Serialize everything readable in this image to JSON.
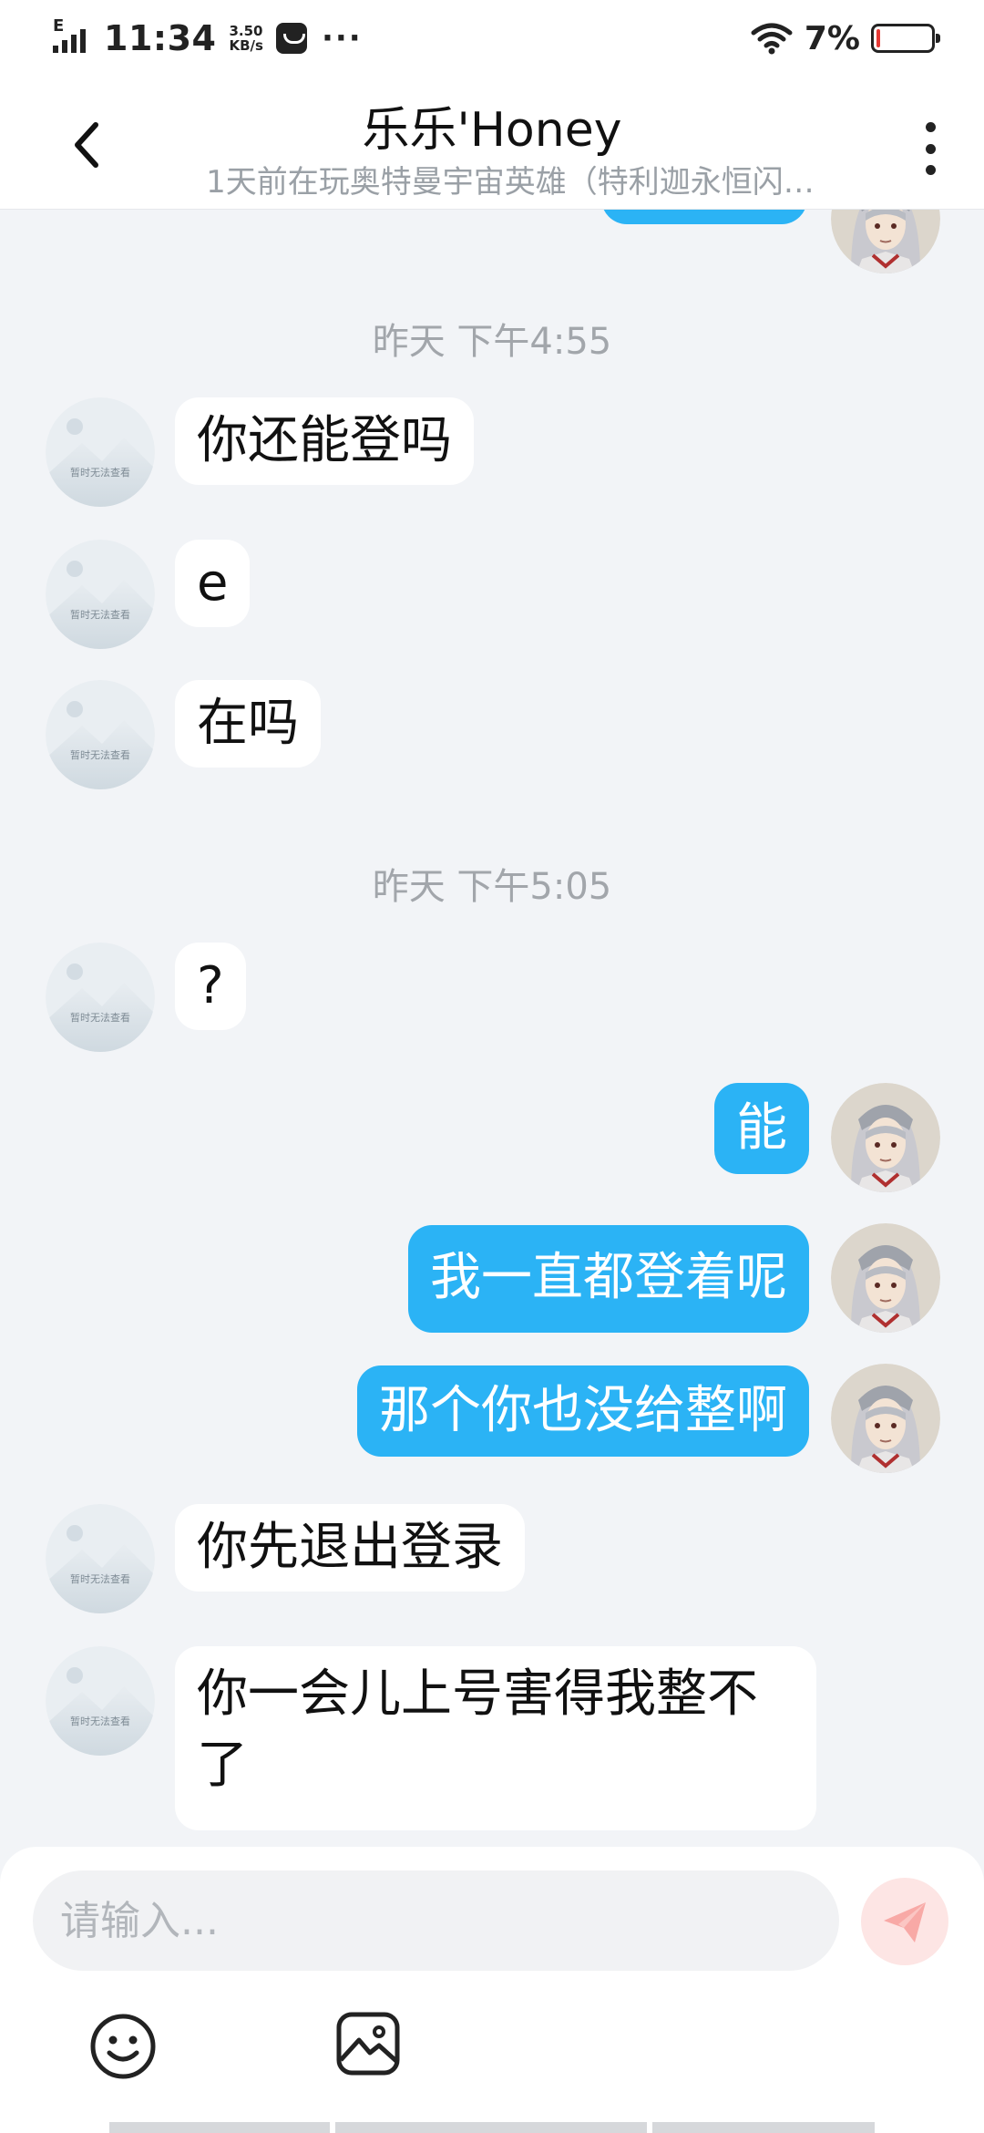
{
  "status_bar": {
    "network_type": "E",
    "time": "11:34",
    "speed_value": "3.50",
    "speed_unit": "KB/s",
    "more": "···",
    "battery_percent_text": "7%",
    "battery_level": 0.07,
    "battery_color": "#e53935"
  },
  "header": {
    "title": "乐乐'Honey",
    "subtitle": "1天前在玩奥特曼宇宙英雄（特利迦永恒闪…"
  },
  "chat": {
    "timestamps": [
      "昨天 下午4:55",
      "昨天 下午5:05"
    ],
    "avatar_placeholder_text": "暂时无法查看",
    "messages": [
      {
        "side": "in",
        "text": "你还能登吗"
      },
      {
        "side": "in",
        "text": "e"
      },
      {
        "side": "in",
        "text": "在吗"
      },
      {
        "side": "in",
        "text": "?"
      },
      {
        "side": "out",
        "text": "能"
      },
      {
        "side": "out",
        "text": "我一直都登着呢"
      },
      {
        "side": "out",
        "text": "那个你也没给整啊"
      },
      {
        "side": "in",
        "text": "你先退出登录"
      },
      {
        "side": "in",
        "text": "你一会儿上号害得我整不了"
      }
    ]
  },
  "input": {
    "placeholder": "请输入...",
    "value": ""
  },
  "colors": {
    "accent_bubble": "#2bb3f5",
    "send_button_bg": "#fde5e4",
    "send_icon": "#f8a9a6"
  },
  "icons": {
    "back": "chevron-left-icon",
    "menu": "more-vertical-icon",
    "send": "paper-plane-icon",
    "emoji": "smiley-icon",
    "image": "image-icon"
  }
}
